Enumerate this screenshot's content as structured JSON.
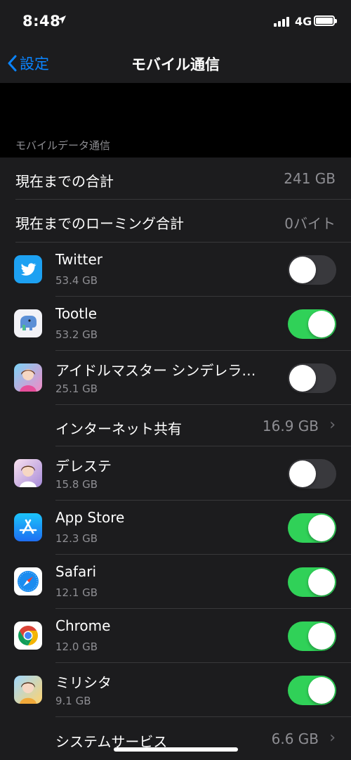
{
  "status": {
    "time": "8:48",
    "network": "4G"
  },
  "nav": {
    "back_label": "設定",
    "title": "モバイル通信"
  },
  "section_header": "モバイルデータ通信",
  "totals": [
    {
      "label": "現在までの合計",
      "value": "241 GB"
    },
    {
      "label": "現在までのローミング合計",
      "value": "0バイト"
    }
  ],
  "apps": [
    {
      "name": "Twitter",
      "usage": "53.4 GB",
      "enabled": false,
      "icon": "twitter-icon"
    },
    {
      "name": "Tootle",
      "usage": "53.2 GB",
      "enabled": true,
      "icon": "tootle-icon"
    },
    {
      "name": "アイドルマスター シンデレラ…",
      "usage": "25.1 GB",
      "enabled": false,
      "icon": "idolmaster-icon"
    },
    {
      "name": "デレステ",
      "usage": "15.8 GB",
      "enabled": false,
      "icon": "deresute-icon"
    },
    {
      "name": "App Store",
      "usage": "12.3 GB",
      "enabled": true,
      "icon": "app-store-icon"
    },
    {
      "name": "Safari",
      "usage": "12.1 GB",
      "enabled": true,
      "icon": "safari-icon"
    },
    {
      "name": "Chrome",
      "usage": "12.0 GB",
      "enabled": true,
      "icon": "chrome-icon"
    },
    {
      "name": "ミリシタ",
      "usage": "9.1 GB",
      "enabled": true,
      "icon": "millishita-icon"
    }
  ],
  "hotspot": {
    "label": "インターネット共有",
    "value": "16.9 GB"
  },
  "system_services": {
    "label": "システムサービス",
    "value": "6.6 GB"
  },
  "colors": {
    "accent": "#0a84ff",
    "toggle_on": "#30d158",
    "toggle_off": "#39393d",
    "background": "#1c1c1e"
  }
}
